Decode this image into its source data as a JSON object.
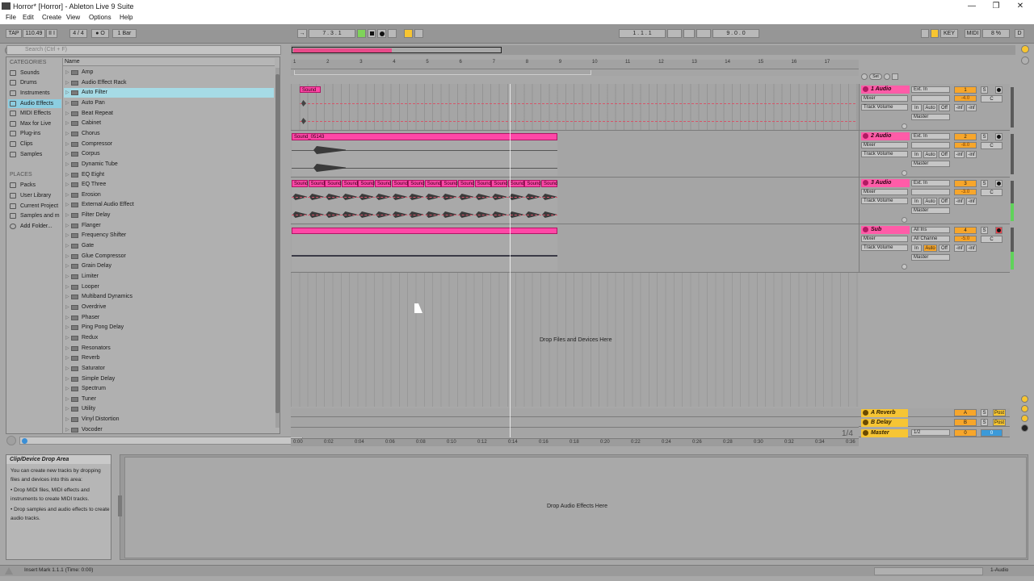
{
  "window": {
    "title": "Horror* [Horror] - Ableton Live 9 Suite",
    "controls": [
      "—",
      "❐",
      "✕"
    ]
  },
  "menu": [
    "File",
    "Edit",
    "Create",
    "View",
    "Options",
    "Help"
  ],
  "control_bar": {
    "tap": "TAP",
    "tempo": "110.49",
    "nudge": "II I",
    "signature": "4 / 4",
    "metronome": "● O",
    "quantization": "1 Bar",
    "follow": "→",
    "position": "7 .  3 .  1",
    "loop_start": "1 .  1 .  1",
    "loop_length": "9 .  0 .  0",
    "key": "KEY",
    "midi": "MIDI",
    "cpu": "8 %",
    "d": "D"
  },
  "browser": {
    "search_placeholder": "Search (Ctrl + F)",
    "categories_heading": "CATEGORIES",
    "categories": [
      "Sounds",
      "Drums",
      "Instruments",
      "Audio Effects",
      "MIDI Effects",
      "Max for Live",
      "Plug-ins",
      "Clips",
      "Samples"
    ],
    "places_heading": "PLACES",
    "places": [
      "Packs",
      "User Library",
      "Current Project",
      "Samples and m",
      "Add Folder..."
    ],
    "name_header": "Name",
    "items": [
      "Amp",
      "Audio Effect Rack",
      "Auto Filter",
      "Auto Pan",
      "Beat Repeat",
      "Cabinet",
      "Chorus",
      "Compressor",
      "Corpus",
      "Dynamic Tube",
      "EQ Eight",
      "EQ Three",
      "Erosion",
      "External Audio Effect",
      "Filter Delay",
      "Flanger",
      "Frequency Shifter",
      "Gate",
      "Glue Compressor",
      "Grain Delay",
      "Limiter",
      "Looper",
      "Multiband Dynamics",
      "Overdrive",
      "Phaser",
      "Ping Pong Delay",
      "Redux",
      "Resonators",
      "Reverb",
      "Saturator",
      "Simple Delay",
      "Spectrum",
      "Tuner",
      "Utility",
      "Vinyl Distortion",
      "Vocoder"
    ],
    "selected_item": "Auto Filter"
  },
  "arrangement": {
    "bar_ticks": [
      "1",
      "2",
      "3",
      "4",
      "5",
      "6",
      "7",
      "8",
      "9",
      "10",
      "11",
      "12",
      "13",
      "14",
      "15",
      "16",
      "17"
    ],
    "time_ticks": [
      "0:00",
      "0:02",
      "0:04",
      "0:06",
      "0:08",
      "0:10",
      "0:12",
      "0:14",
      "0:16",
      "0:18",
      "0:20",
      "0:22",
      "0:24",
      "0:26",
      "0:28",
      "0:30",
      "0:32",
      "0:34",
      "0:36"
    ],
    "drop_text": "Drop Files and Devices Here",
    "scroll_fraction": "1/4",
    "clips": {
      "track1": "Sound",
      "track2": "Sound_05143",
      "track3": "Sound"
    }
  },
  "tracks": [
    {
      "name": "1 Audio",
      "input": "Ext. In",
      "mixer": "Mixer",
      "auto": "Track Volume",
      "out": "Master",
      "num": "1",
      "vol": "-4.0",
      "pan": "C",
      "sub": "",
      "color": "#ff5ca8"
    },
    {
      "name": "2 Audio",
      "input": "Ext. In",
      "mixer": "Mixer",
      "auto": "Track Volume",
      "out": "Master",
      "num": "2",
      "vol": "-8.0",
      "pan": "C",
      "sub": "",
      "color": "#ff5ca8"
    },
    {
      "name": "3 Audio",
      "input": "Ext. In",
      "mixer": "Mixer",
      "auto": "Track Volume",
      "out": "Master",
      "num": "3",
      "vol": "-3.0",
      "pan": "C",
      "sub": "",
      "color": "#ff5ca8"
    },
    {
      "name": "Sub",
      "input": "All Ins",
      "mixer": "Mixer",
      "auto": "Track Volume",
      "out": "Master",
      "num": "4",
      "vol": "-5.0",
      "pan": "C",
      "sub": "All Channe",
      "color": "#ff5ca8"
    }
  ],
  "track_buttons": {
    "in": "In",
    "auto": "Auto",
    "off": "Off",
    "inf1": "-inf",
    "inf2": "-inf",
    "solo": "S"
  },
  "returns": [
    {
      "name": "A Reverb",
      "num": "A",
      "solo": "S",
      "post": "Post"
    },
    {
      "name": "B Delay",
      "num": "B",
      "solo": "S",
      "post": "Post"
    },
    {
      "name": "Master",
      "num": "0",
      "solo": "0",
      "post": "",
      "sel": "1/2"
    }
  ],
  "info_view": {
    "title": "Clip/Device Drop Area",
    "text": "You can create new tracks by dropping files and devices into this area:",
    "bullets": [
      "Drop MIDI files, MIDI effects and instruments to create MIDI tracks.",
      "Drop samples and audio effects to create audio tracks."
    ]
  },
  "detail": {
    "drop_text": "Drop Audio Effects Here"
  },
  "status": {
    "text": "Insert Mark 1.1.1 (Time: 0:00)",
    "track": "1-Audio"
  }
}
